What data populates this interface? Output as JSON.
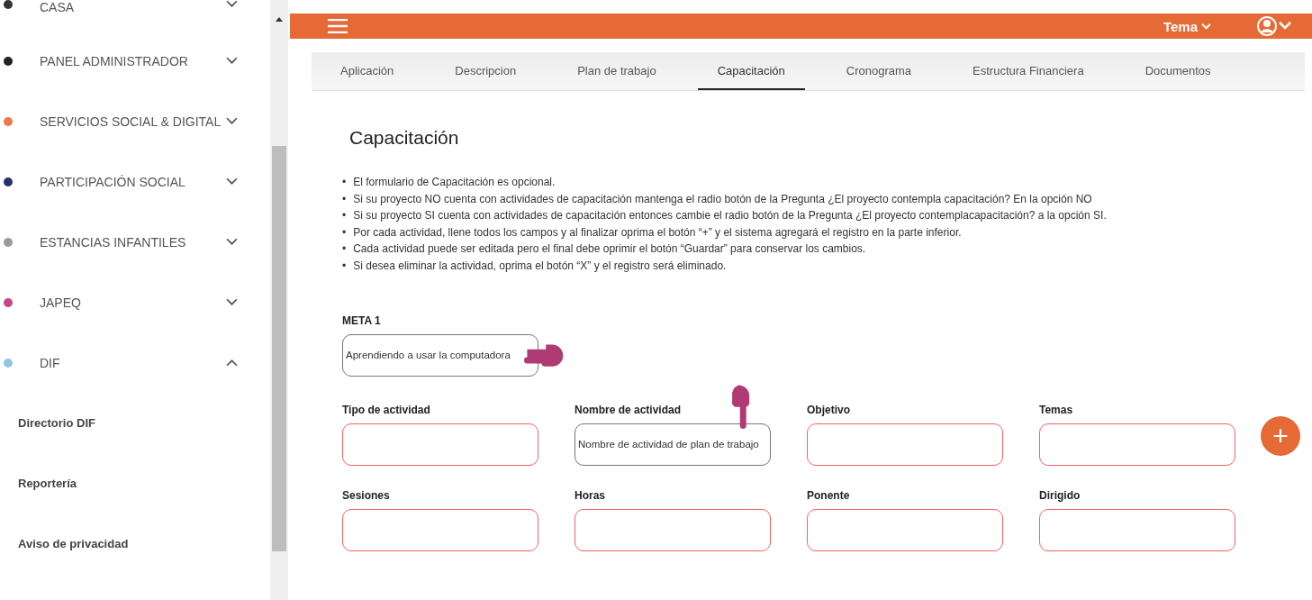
{
  "sidebar": {
    "items": [
      {
        "label": "CASA",
        "color": "#333333",
        "expanded": false
      },
      {
        "label": "PANEL ADMINISTRADOR",
        "color": "#222222",
        "expanded": false
      },
      {
        "label": "SERVICIOS SOCIAL & DIGITAL",
        "color": "#ee7a45",
        "expanded": false
      },
      {
        "label": "PARTICIPACIÓN SOCIAL",
        "color": "#27306b",
        "expanded": false
      },
      {
        "label": "ESTANCIAS INFANTILES",
        "color": "#9a9a9a",
        "expanded": false
      },
      {
        "label": "JAPEQ",
        "color": "#c8458a",
        "expanded": false
      },
      {
        "label": "DIF",
        "color": "#8fc7e0",
        "expanded": true,
        "children": [
          {
            "label": "Directorio DIF"
          },
          {
            "label": "Reportería"
          },
          {
            "label": "Aviso de privacidad"
          }
        ]
      }
    ]
  },
  "header": {
    "theme_menu": "Tema"
  },
  "tabs": [
    {
      "label": "Aplicación",
      "selected": false
    },
    {
      "label": "Descripcion",
      "selected": false
    },
    {
      "label": "Plan de trabajo",
      "selected": false
    },
    {
      "label": "Capacitación",
      "selected": true
    },
    {
      "label": "Cronograma",
      "selected": false
    },
    {
      "label": "Estructura Financiera",
      "selected": false
    },
    {
      "label": "Documentos",
      "selected": false
    }
  ],
  "page": {
    "title": "Capacitación",
    "instructions": [
      {
        "bullet": "•",
        "text": "El formulario de Capacitación es opcional."
      },
      {
        "bullet": "•",
        "text": "Si su proyecto NO cuenta con actividades de capacitación mantenga el radio botón de la Pregunta ¿El proyecto contempla capacitación? En la opción NO"
      },
      {
        "bullet": "•",
        "text": "Si su proyecto SI cuenta con actividades de capacitación entonces cambie el radio botón de la Pregunta ¿El proyecto contemplacapacitación? a la opción SI."
      },
      {
        "bullet": "•",
        "text": "Por cada actividad, llene todos los campos y al finalizar oprima el botón “+” y el sistema agregará el registro en la parte inferior."
      },
      {
        "bullet": "•",
        "text": "Cada actividad puede ser editada pero el final debe oprimir el botón “Guardar” para conservar los cambios."
      },
      {
        "bullet": "•",
        "text": "Si desea eliminar la actividad, oprima el botón “X” y el registro será eliminado."
      }
    ]
  },
  "meta": {
    "label": "META 1",
    "value": "Aprendiendo a usar la computadora",
    "invalid": false,
    "pointer": true
  },
  "fields": [
    {
      "label": "Tipo de actividad",
      "invalid": true,
      "pointer": false
    },
    {
      "label": "Nombre de actividad",
      "value": "Nombre de actividad de plan de trabajo",
      "invalid": false,
      "pointer": true
    },
    {
      "label": "Objetivo",
      "invalid": true,
      "pointer": false
    },
    {
      "label": "Temas",
      "invalid": true,
      "pointer": false
    },
    {
      "label": "Sesiones",
      "invalid": true,
      "pointer": false
    },
    {
      "label": "Horas",
      "invalid": true,
      "pointer": false
    },
    {
      "label": "Ponente",
      "invalid": true,
      "pointer": false
    },
    {
      "label": "Dirigido",
      "invalid": true,
      "pointer": false
    }
  ],
  "add_button": {
    "label": "+"
  }
}
